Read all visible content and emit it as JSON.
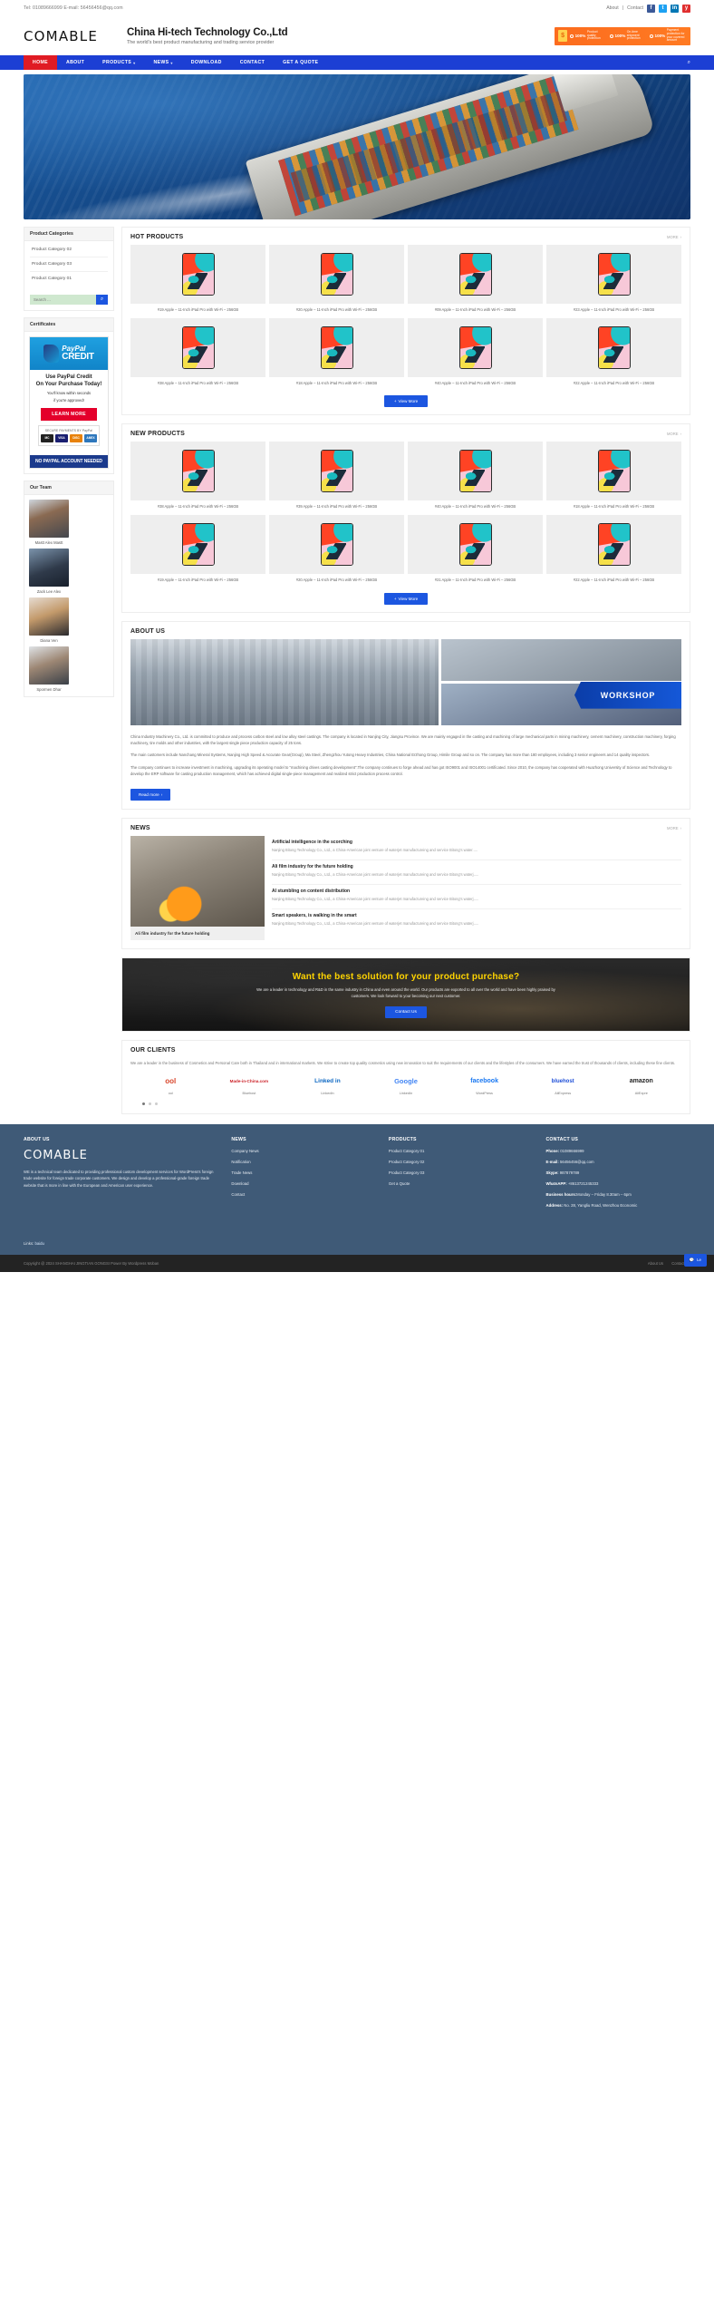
{
  "topbar": {
    "contact": "Tel: 01089666999 E-mail: 56456456@qq.com",
    "about_link": "About",
    "sep": "|",
    "contact_link": "Contact",
    "social": [
      "f",
      "t",
      "in",
      "y"
    ]
  },
  "header": {
    "logo": "COMABLE",
    "company": "China Hi-tech Technology Co.,Ltd",
    "tagline": "The world's best product manufacturing and trading service provider",
    "promo": [
      {
        "pct": "100%",
        "text": "Product quality protection"
      },
      {
        "pct": "100%",
        "text": "On-time shipment protection"
      },
      {
        "pct": "100%",
        "text": "Payment protection for your covered amount"
      }
    ]
  },
  "nav": {
    "items": [
      {
        "label": "HOME",
        "active": true,
        "caret": false
      },
      {
        "label": "ABOUT",
        "active": false,
        "caret": false
      },
      {
        "label": "PRODUCTS",
        "active": false,
        "caret": true
      },
      {
        "label": "NEWS",
        "active": false,
        "caret": true
      },
      {
        "label": "DOWNLOAD",
        "active": false,
        "caret": false
      },
      {
        "label": "CONTACT",
        "active": false,
        "caret": false
      },
      {
        "label": "GET A QUOTE",
        "active": false,
        "caret": false
      }
    ],
    "search_icon": "search-icon"
  },
  "sidebar": {
    "categories_title": "Product Categories",
    "categories": [
      "Product Category 02",
      "Product Category 03",
      "Product Category 01"
    ],
    "search_placeholder": "Search ...",
    "certificates_title": "Certificates",
    "paypal": {
      "brand_1": "PayPal",
      "brand_2": "CREDIT",
      "head_line1": "Use PayPal Credit",
      "head_line2": "On Your Purchase Today!",
      "sub_line1": "You'll know within seconds",
      "sub_line2": "if you're approved!",
      "cta": "LEARN MORE",
      "secure_label": "SECURE PAYMENTS BY PayPal",
      "cards": [
        "MasterCard",
        "VISA",
        "DISCOVER",
        "AMEX"
      ],
      "footer": "NO PAYPAL ACCOUNT NEEDED"
    },
    "team_title": "Our Team",
    "team": [
      "Mastt Alex Mastt",
      "Zack Lee Alex",
      "Diana Ven",
      "Spormen Dhar"
    ]
  },
  "hot_products": {
    "title": "HOT PRODUCTS",
    "more": "MORE",
    "items": [
      "#19 Apple – 11-Inch iPad Pro with Wi-Fi – 256GB",
      "#20 Apple – 11-Inch iPad Pro with Wi-Fi – 256GB",
      "#09 Apple – 11-Inch iPad Pro with Wi-Fi – 256GB",
      "#23 Apple – 11-Inch iPad Pro with Wi-Fi – 256GB",
      "#38 Apple – 11-Inch iPad Pro with Wi-Fi – 256GB",
      "#18 Apple – 11-Inch iPad Pro with Wi-Fi – 256GB",
      "#40 Apple – 11-Inch iPad Pro with Wi-Fi – 256GB",
      "#22 Apple – 11-Inch iPad Pro with Wi-Fi – 256GB"
    ],
    "view_more": "View More"
  },
  "new_products": {
    "title": "NEW PRODUCTS",
    "more": "MORE",
    "items": [
      "#38 Apple – 11-Inch iPad Pro with Wi-Fi – 256GB",
      "#39 Apple – 11-Inch iPad Pro with Wi-Fi – 256GB",
      "#40 Apple – 11-Inch iPad Pro with Wi-Fi – 256GB",
      "#18 Apple – 11-Inch iPad Pro with Wi-Fi – 256GB",
      "#19 Apple – 11-Inch iPad Pro with Wi-Fi – 256GB",
      "#20 Apple – 11-Inch iPad Pro with Wi-Fi – 256GB",
      "#21 Apple – 11-Inch iPad Pro with Wi-Fi – 256GB",
      "#22 Apple – 11-Inch iPad Pro with Wi-Fi – 256GB"
    ],
    "view_more": "View More"
  },
  "about": {
    "title": "ABOUT US",
    "badge": "WORKSHOP",
    "p1": "China Industry Machinery Co., Ltd. is committed to produce and process carbon steel and low alloy steel castings. The company is located in Nanjing City, Jiangsu Province. We are mainly engaged in the casting and machining of large mechanical parts in mining machinery, cement machinery, construction machinery, forging machinery, tire molds and other industries, with the largest single piece production capacity of 25 tons.",
    "p2": "The main customers include Nanchang Mineral Systems, Nanjing High Speed & Accurate Gear(Group), Ma Steel, Zhengzhou Yutong Heavy Industries, China National Erzhong Group, Himile Group and so on. The company has more than 180 employees, including 3 senior engineers and 14 quality inspectors.",
    "p3": "The company continues to increase investment in machining, upgrading its operating model to \"machining drives casting development\".The company continues to forge ahead and has got ISO9001 and ISO14001 certificated. Since 2010, the company has cooperated with Huazhong University of Science and Technology to develop the ERP software for casting production management, which has achieved digital single-piece management and realized strict production process control.",
    "read_more": "Read more"
  },
  "news": {
    "title": "NEWS",
    "more": "MORE",
    "feature_caption": "Ali film industry for the future holding",
    "items": [
      {
        "title": "Artificial intelligence in the scorching",
        "desc": "Nanjing Bitong Technology Co., Ltd., a China-American joint venture of waterjet manufactureing and service Bitong's water....."
      },
      {
        "title": "Ali film industry for the future holding",
        "desc": "Nanjing Bitong Technology Co., Ltd., a China-American joint venture of waterjet manufactureing and service Bitong's waterj....."
      },
      {
        "title": "AI stumbling on content distribution",
        "desc": "Nanjing Bitong Technology Co., Ltd., a China-American joint venture of waterjet manufactureing and service Bitong's waterj....."
      },
      {
        "title": "Smart speakers, is walking in the smart",
        "desc": "Nanjing Bitong Technology Co., Ltd., a China-American joint venture of waterjet manufactureing and service Bitong's waterj....."
      }
    ]
  },
  "cta": {
    "headline": "Want the best solution for your product purchase?",
    "sub": "We are a leader in technology and R&D in the same industry in China and even around the world. Our products are exported to all over the world and have been highly praised by customers. We look forward to your becoming our next customer.",
    "button": "Contact Us"
  },
  "clients": {
    "title": "OUR CLIENTS",
    "desc": "We are a leader in the business of Cosmetics and Personal Care both in Thailand and in international markets. We strive to create top quality cosmetics using new innovation to suit the requirements of our clients and the lifestyles of the consumers. We have earned the trust of thousands of clients, including these fine clients.",
    "logos": [
      {
        "mark": "ool",
        "cap": "ool"
      },
      {
        "mark": "Made-in-China.com",
        "cap": "Bluehost"
      },
      {
        "mark": "Linked in",
        "cap": "LinkedIn"
      },
      {
        "mark": "Google",
        "cap": "LinkedIn"
      },
      {
        "mark": "facebook",
        "cap": "WordPress"
      },
      {
        "mark": "bluehost",
        "cap": "AliExpress"
      },
      {
        "mark": "amazon",
        "cap": "AliExpre"
      }
    ],
    "dots": 3
  },
  "footer": {
    "about_title": "ABOUT US",
    "logo": "COMABLE",
    "about_desc": "WE is a technical team dedicated to providing professional custom development services for WordPress's foreign trade website for foreign trade corporate customers. We design and develop a professional-grade foreign trade website that is more in line with the European and American user experience.",
    "news_title": "NEWS",
    "news_links": [
      "Company News",
      "Notification",
      "Trade News",
      "Download",
      "Contact"
    ],
    "products_title": "PRODUCTS",
    "product_links": [
      "Product Category 01",
      "Product Category 02",
      "Product Category 03",
      "Get a Quote"
    ],
    "contact_title": "CONTACT US",
    "contact": [
      {
        "label": "Phone:",
        "value": " 01089666999"
      },
      {
        "label": "E-mail:",
        "value": " 56456456@qq.com"
      },
      {
        "label": "Skype:",
        "value": " 987879789"
      },
      {
        "label": "WhatsAPP:",
        "value": " +8613721245333"
      },
      {
        "label": "Business hours:",
        "value": "Monday – Friday 8.30am – 6pm"
      },
      {
        "label": "Address:",
        "value": " No. 28, Yangliu Road, Wenzhou Economic"
      }
    ],
    "links_label": "Links:",
    "links_value": "baidu",
    "copyright": "Copyright @ 2024 SHANGHAI JINGTIAN GONGSI Power By Wordpress Moban",
    "bottom_links": [
      "About Us",
      "Contact Us"
    ],
    "chat": "Le"
  }
}
